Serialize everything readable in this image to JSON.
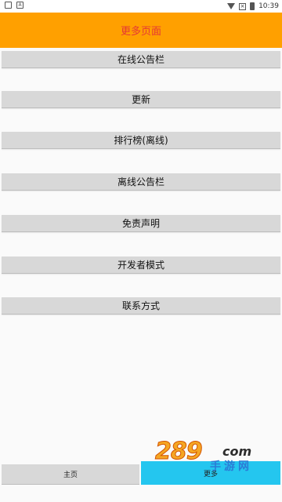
{
  "status_bar": {
    "time": "10:39",
    "icons": [
      "app-notification-icon",
      "download-notification-icon",
      "wifi-icon",
      "no-sim-icon",
      "battery-icon"
    ]
  },
  "header": {
    "title": "更多页面"
  },
  "menu": {
    "items": [
      {
        "label": "在线公告栏"
      },
      {
        "label": "更新"
      },
      {
        "label": "排行榜(离线)"
      },
      {
        "label": "离线公告栏"
      },
      {
        "label": "免责声明"
      },
      {
        "label": "开发者模式"
      },
      {
        "label": "联系方式"
      }
    ]
  },
  "bottom_nav": {
    "home_label": "主页",
    "more_label": "更多"
  },
  "watermark": {
    "num": "289",
    "suffix": "com",
    "cn": "手游网"
  },
  "colors": {
    "header_bg": "#ffa000",
    "title_color": "#e53935",
    "button_bg": "#d8d8d8",
    "active_tab": "#24c6ef"
  }
}
